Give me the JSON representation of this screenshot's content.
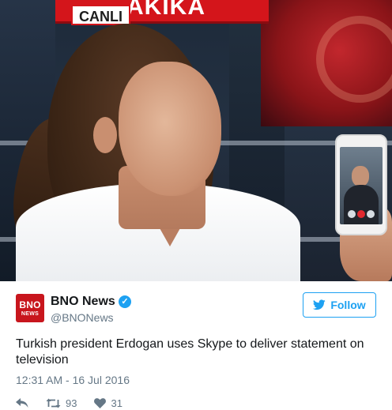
{
  "media": {
    "live_label": "CANLI",
    "banner_text": "AKIKA"
  },
  "tweet": {
    "avatar_text_top": "BNO",
    "avatar_text_bottom": "NEWS",
    "display_name": "BNO News",
    "verified_icon": "verified-badge-icon",
    "handle": "@BNONews",
    "follow_label": "Follow",
    "follow_icon": "twitter-bird-icon",
    "text": "Turkish president Erdogan uses Skype to deliver statement on television",
    "timestamp": "12:31 AM - 16 Jul 2016",
    "actions": {
      "reply_icon": "reply-icon",
      "retweet_icon": "retweet-icon",
      "retweet_count": "93",
      "like_icon": "heart-icon",
      "like_count": "31"
    }
  },
  "colors": {
    "accent": "#1da1f2",
    "brand_red": "#c8161d",
    "muted_text": "#657786"
  }
}
